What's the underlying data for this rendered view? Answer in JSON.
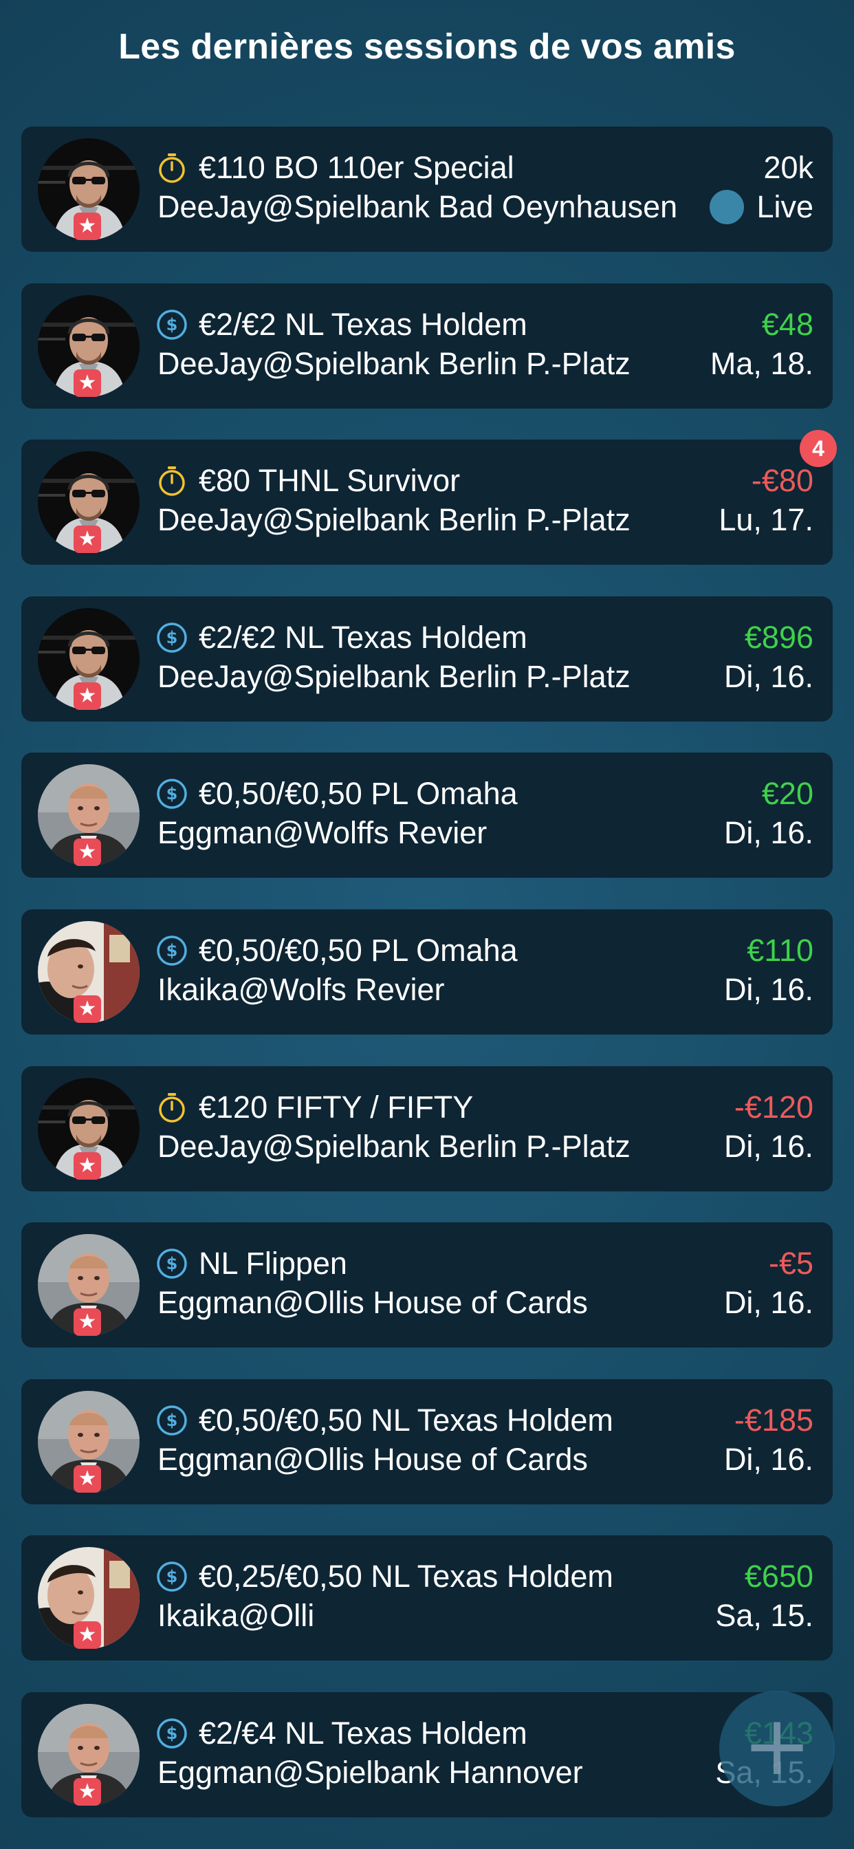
{
  "title": "Les dernières sessions de vos amis",
  "colors": {
    "positive": "#3fd24a",
    "negative": "#ee5a5a",
    "tournament_icon": "#f2c230",
    "cash_icon": "#52aee0",
    "star_badge": "#e94b57",
    "live_dot": "#3a86a9"
  },
  "sessions": [
    {
      "type": "tournament-timer-icon",
      "avatar": "deejay",
      "game": "€110 BO 110er Special",
      "player_venue": "DeeJay@Spielbank Bad Oeynhausen",
      "amount": "20k",
      "sign": "neutral",
      "date": "",
      "live": true,
      "live_label": "Live",
      "badge": ""
    },
    {
      "type": "cash-dollar-icon",
      "avatar": "deejay",
      "game": "€2/€2 NL Texas Holdem",
      "player_venue": "DeeJay@Spielbank Berlin P.-Platz",
      "amount": "€48",
      "sign": "pos",
      "date": "Ma, 18.",
      "live": false,
      "live_label": "",
      "badge": ""
    },
    {
      "type": "tournament-timer-icon",
      "avatar": "deejay",
      "game": "€80 THNL Survivor",
      "player_venue": "DeeJay@Spielbank Berlin P.-Platz",
      "amount": "-€80",
      "sign": "neg",
      "date": "Lu, 17.",
      "live": false,
      "live_label": "",
      "badge": "4"
    },
    {
      "type": "cash-dollar-icon",
      "avatar": "deejay",
      "game": "€2/€2 NL Texas Holdem",
      "player_venue": "DeeJay@Spielbank Berlin P.-Platz",
      "amount": "€896",
      "sign": "pos",
      "date": "Di, 16.",
      "live": false,
      "live_label": "",
      "badge": ""
    },
    {
      "type": "cash-dollar-icon",
      "avatar": "eggman",
      "game": "€0,50/€0,50 PL Omaha",
      "player_venue": "Eggman@Wolffs Revier",
      "amount": "€20",
      "sign": "pos",
      "date": "Di, 16.",
      "live": false,
      "live_label": "",
      "badge": ""
    },
    {
      "type": "cash-dollar-icon",
      "avatar": "ikaika",
      "game": "€0,50/€0,50 PL Omaha",
      "player_venue": "Ikaika@Wolfs Revier",
      "amount": "€110",
      "sign": "pos",
      "date": "Di, 16.",
      "live": false,
      "live_label": "",
      "badge": ""
    },
    {
      "type": "tournament-timer-icon",
      "avatar": "deejay",
      "game": "€120 FIFTY / FIFTY",
      "player_venue": "DeeJay@Spielbank Berlin P.-Platz",
      "amount": "-€120",
      "sign": "neg",
      "date": "Di, 16.",
      "live": false,
      "live_label": "",
      "badge": ""
    },
    {
      "type": "cash-dollar-icon",
      "avatar": "eggman",
      "game": "NL Flippen",
      "player_venue": "Eggman@Ollis House of Cards",
      "amount": "-€5",
      "sign": "neg",
      "date": "Di, 16.",
      "live": false,
      "live_label": "",
      "badge": ""
    },
    {
      "type": "cash-dollar-icon",
      "avatar": "eggman",
      "game": "€0,50/€0,50 NL Texas Holdem",
      "player_venue": "Eggman@Ollis House of Cards",
      "amount": "-€185",
      "sign": "neg",
      "date": "Di, 16.",
      "live": false,
      "live_label": "",
      "badge": ""
    },
    {
      "type": "cash-dollar-icon",
      "avatar": "ikaika",
      "game": "€0,25/€0,50 NL Texas Holdem",
      "player_venue": "Ikaika@Olli",
      "amount": "€650",
      "sign": "pos",
      "date": "Sa, 15.",
      "live": false,
      "live_label": "",
      "badge": ""
    },
    {
      "type": "cash-dollar-icon",
      "avatar": "eggman",
      "game": "€2/€4 NL Texas Holdem",
      "player_venue": "Eggman@Spielbank Hannover",
      "amount": "€143",
      "sign": "pos",
      "date": "Sa, 15.",
      "live": false,
      "live_label": "",
      "badge": ""
    }
  ],
  "fab": {
    "icon": "plus-icon",
    "symbol": "+"
  }
}
